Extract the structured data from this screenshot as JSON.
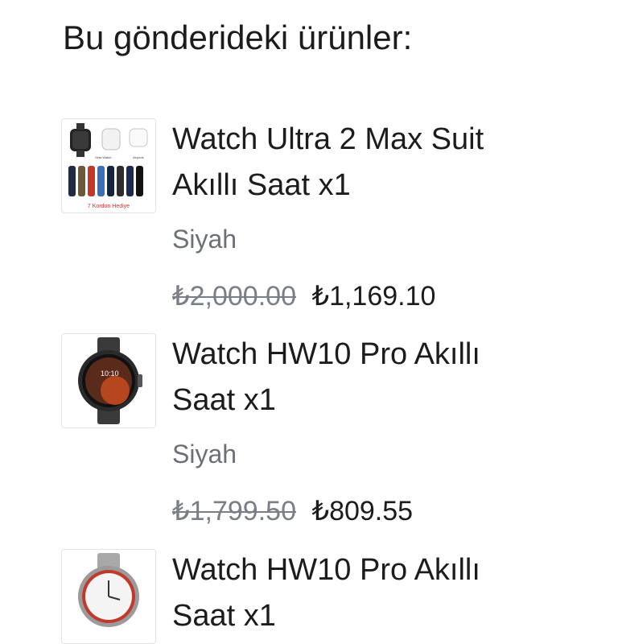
{
  "section": {
    "title": "Bu gönderideki ürünler:"
  },
  "items": [
    {
      "name_line1": "Watch Ultra 2 Max Suit",
      "name_line2": "Akıllı Saat x1",
      "variant": "Siyah",
      "old_price": "₺2,000.00",
      "price": "₺1,169.10",
      "thumb_icon": "watch-bundle-with-straps-icon",
      "thumb_label_a": "Seta Watch",
      "thumb_label_b": "Airpods",
      "thumb_caption": "7 Kordon Hediye"
    },
    {
      "name_line1": "Watch HW10 Pro Akıllı",
      "name_line2": "Saat x1",
      "variant": "Siyah",
      "old_price": "₺1,799.50",
      "price": "₺809.55",
      "thumb_icon": "round-smartwatch-black-icon"
    },
    {
      "name_line1": "Watch HW10 Pro Akıllı",
      "name_line2": "Saat x1",
      "thumb_icon": "round-smartwatch-silver-icon"
    }
  ],
  "colors": {
    "text": "#1c1c1c",
    "muted": "#6b6f78",
    "strike": "#7a7e86",
    "accent_red": "#d32f2f"
  }
}
